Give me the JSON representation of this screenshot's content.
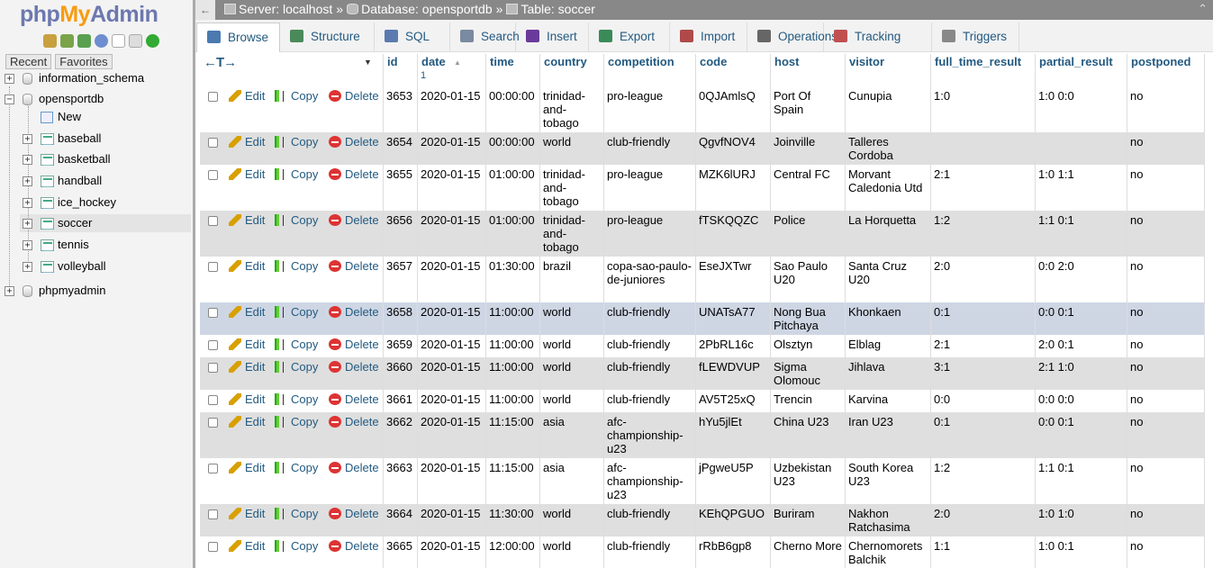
{
  "nav": {
    "logo_php": "php",
    "logo_my": "My",
    "logo_admin": "Admin",
    "tabs": [
      "Recent",
      "Favorites"
    ],
    "tree": [
      {
        "label": "information_schema",
        "kind": "db"
      },
      {
        "label": "opensportdb",
        "kind": "db"
      },
      {
        "label": "New",
        "kind": "new"
      },
      {
        "label": "baseball",
        "kind": "table"
      },
      {
        "label": "basketball",
        "kind": "table"
      },
      {
        "label": "handball",
        "kind": "table"
      },
      {
        "label": "ice_hockey",
        "kind": "table"
      },
      {
        "label": "soccer",
        "kind": "table"
      },
      {
        "label": "tennis",
        "kind": "table"
      },
      {
        "label": "volleyball",
        "kind": "table"
      },
      {
        "label": "phpmyadmin",
        "kind": "db"
      }
    ]
  },
  "breadcrumb": {
    "back": "←",
    "server": "Server: localhost",
    "database": "Database: opensportdb",
    "table": "Table: soccer",
    "sep": "»",
    "collapse": "⌃"
  },
  "menu": [
    "Browse",
    "Structure",
    "SQL",
    "Search",
    "Insert",
    "Export",
    "Import",
    "Operations",
    "Tracking",
    "Triggers"
  ],
  "table": {
    "col_arrows": "←T→",
    "chevron": "▼",
    "sort_arrow": "▲",
    "sort_index": "1",
    "headers": [
      "id",
      "date",
      "time",
      "country",
      "competition",
      "code",
      "host",
      "visitor",
      "full_time_result",
      "partial_result",
      "postponed"
    ],
    "actions": {
      "edit": "Edit",
      "copy": "Copy",
      "delete": "Delete"
    },
    "rows": [
      [
        "3653",
        "2020-01-15",
        "00:00:00",
        "trinidad-and-tobago",
        "pro-league",
        "0QJAmlsQ",
        "Port Of Spain",
        "Cunupia",
        "1:0",
        "1:0 0:0",
        "no"
      ],
      [
        "3654",
        "2020-01-15",
        "00:00:00",
        "world",
        "club-friendly",
        "QgvfNOV4",
        "Joinville",
        "Talleres Cordoba",
        "",
        "",
        "no"
      ],
      [
        "3655",
        "2020-01-15",
        "01:00:00",
        "trinidad-and-tobago",
        "pro-league",
        "MZK6lURJ",
        "Central FC",
        "Morvant Caledonia Utd",
        "2:1",
        "1:0 1:1",
        "no"
      ],
      [
        "3656",
        "2020-01-15",
        "01:00:00",
        "trinidad-and-tobago",
        "pro-league",
        "fTSKQQZC",
        "Police",
        "La Horquetta",
        "1:2",
        "1:1 0:1",
        "no"
      ],
      [
        "3657",
        "2020-01-15",
        "01:30:00",
        "brazil",
        "copa-sao-paulo-de-juniores",
        "EseJXTwr",
        "Sao Paulo U20",
        "Santa Cruz U20",
        "2:0",
        "0:0 2:0",
        "no"
      ],
      [
        "3658",
        "2020-01-15",
        "11:00:00",
        "world",
        "club-friendly",
        "UNATsA77",
        "Nong Bua Pitchaya",
        "Khonkaen",
        "0:1",
        "0:0 0:1",
        "no"
      ],
      [
        "3659",
        "2020-01-15",
        "11:00:00",
        "world",
        "club-friendly",
        "2PbRL16c",
        "Olsztyn",
        "Elblag",
        "2:1",
        "2:0 0:1",
        "no"
      ],
      [
        "3660",
        "2020-01-15",
        "11:00:00",
        "world",
        "club-friendly",
        "fLEWDVUP",
        "Sigma Olomouc",
        "Jihlava",
        "3:1",
        "2:1 1:0",
        "no"
      ],
      [
        "3661",
        "2020-01-15",
        "11:00:00",
        "world",
        "club-friendly",
        "AV5T25xQ",
        "Trencin",
        "Karvina",
        "0:0",
        "0:0 0:0",
        "no"
      ],
      [
        "3662",
        "2020-01-15",
        "11:15:00",
        "asia",
        "afc-championship-u23",
        "hYu5jlEt",
        "China U23",
        "Iran U23",
        "0:1",
        "0:0 0:1",
        "no"
      ],
      [
        "3663",
        "2020-01-15",
        "11:15:00",
        "asia",
        "afc-championship-u23",
        "jPgweU5P",
        "Uzbekistan U23",
        "South Korea U23",
        "1:2",
        "1:1 0:1",
        "no"
      ],
      [
        "3664",
        "2020-01-15",
        "11:30:00",
        "world",
        "club-friendly",
        "KEhQPGUO",
        "Buriram",
        "Nakhon Ratchasima",
        "2:0",
        "1:0 1:0",
        "no"
      ],
      [
        "3665",
        "2020-01-15",
        "12:00:00",
        "world",
        "club-friendly",
        "rRbB6gp8",
        "Cherno More",
        "Chernomorets Balchik",
        "1:1",
        "1:0 0:1",
        "no"
      ]
    ]
  }
}
